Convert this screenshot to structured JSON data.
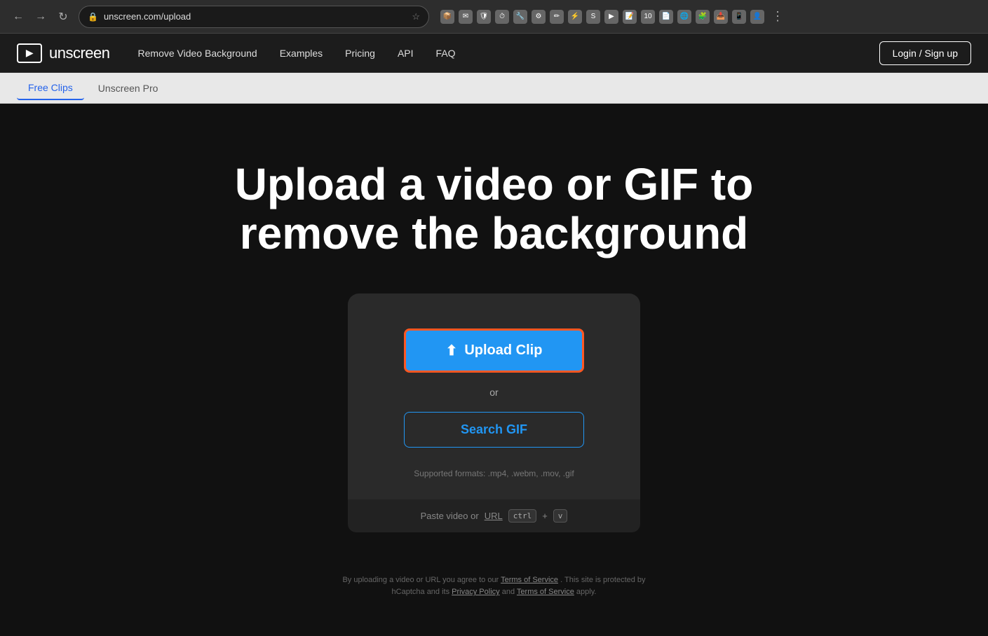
{
  "browser": {
    "url": "unscreen.com/upload",
    "nav_back": "←",
    "nav_forward": "→",
    "nav_reload": "↻"
  },
  "site": {
    "logo_text": "unscreen",
    "nav": {
      "remove_bg": "Remove Video Background",
      "examples": "Examples",
      "pricing": "Pricing",
      "api": "API",
      "faq": "FAQ",
      "login": "Login / Sign up"
    },
    "sub_nav": {
      "free_clips": "Free Clips",
      "unscreen_pro": "Unscreen Pro"
    }
  },
  "main": {
    "hero_title": "Upload a video or GIF to remove the background",
    "upload_btn": "Upload Clip",
    "or_text": "or",
    "search_gif_btn": "Search GIF",
    "supported_formats": "Supported formats: .mp4, .webm, .mov, .gif",
    "paste_label": "Paste video or",
    "paste_url": "URL",
    "paste_hint_ctrl": "ctrl",
    "paste_hint_plus": "+",
    "paste_hint_v": "v"
  },
  "footer": {
    "text_1": "By uploading a video or URL you agree to our ",
    "terms_link_1": "Terms of Service",
    "text_2": ". This site is protected by hCaptcha and its ",
    "privacy_link": "Privacy Policy",
    "text_3": " and ",
    "terms_link_2": "Terms of Service",
    "text_4": " apply."
  }
}
